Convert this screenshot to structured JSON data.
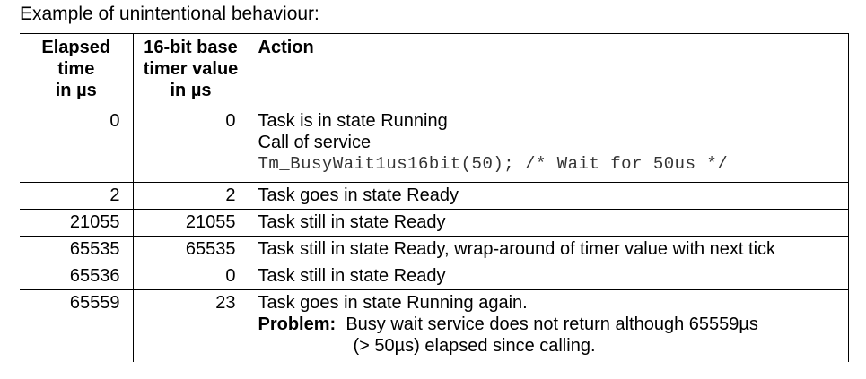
{
  "caption": "Example of unintentional behaviour:",
  "table": {
    "headers": {
      "elapsed": [
        "Elapsed",
        "time",
        "in µs"
      ],
      "timer": [
        "16-bit base",
        "timer value",
        "in µs"
      ],
      "action": "Action"
    },
    "rows": [
      {
        "elapsed": "0",
        "timer": "0",
        "action": {
          "line1": "Task is in state Running",
          "line2": "Call of service",
          "code": "Tm_BusyWait1us16bit(50); /* Wait for 50us */"
        }
      },
      {
        "elapsed": "2",
        "timer": "2",
        "action": {
          "line1": "Task goes in state Ready"
        }
      },
      {
        "elapsed": "21055",
        "timer": "21055",
        "action": {
          "line1": "Task still in state Ready"
        }
      },
      {
        "elapsed": "65535",
        "timer": "65535",
        "action": {
          "line1": "Task still in state Ready, wrap-around of timer value with next tick"
        }
      },
      {
        "elapsed": "65536",
        "timer": "0",
        "action": {
          "line1": "Task still in state Ready"
        }
      },
      {
        "elapsed": "65559",
        "timer": "23",
        "action": {
          "line1": "Task goes in state Running again.",
          "problem_label": "Problem:",
          "problem_text": "Busy wait service does not return although 65559µs",
          "problem_text2": "(> 50µs) elapsed since calling."
        }
      }
    ]
  }
}
